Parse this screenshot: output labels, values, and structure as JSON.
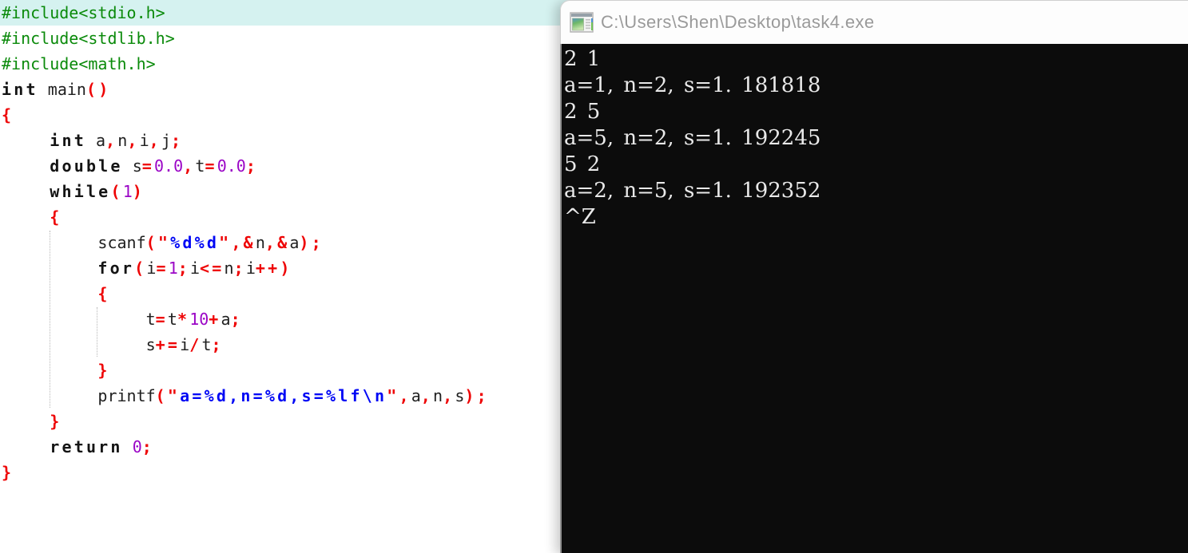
{
  "editor": {
    "background": "#ffffff",
    "active_line_background": "#d5f2f0",
    "token_colors": {
      "include_directive": "#0a8a0a",
      "keyword": "#141414",
      "plain": "#1f1f1f",
      "punctuation": "#ee0405",
      "number": "#9b06c6",
      "string_format": "#0007f5"
    },
    "lines": [
      [
        [
          "inc",
          "#include<stdio.h>"
        ]
      ],
      [
        [
          "inc",
          "#include<stdlib.h>"
        ]
      ],
      [
        [
          "inc",
          "#include<math.h>"
        ]
      ],
      [
        [
          "kw",
          "int"
        ],
        [
          "pl",
          " main"
        ],
        [
          "pu",
          "()"
        ]
      ],
      [
        [
          "pu",
          "{"
        ]
      ],
      [
        [
          "pl",
          "     "
        ],
        [
          "kw",
          "int"
        ],
        [
          "pl",
          " a"
        ],
        [
          "pu",
          ","
        ],
        [
          "pl",
          "n"
        ],
        [
          "pu",
          ","
        ],
        [
          "pl",
          "i"
        ],
        [
          "pu",
          ","
        ],
        [
          "pl",
          "j"
        ],
        [
          "pu",
          ";"
        ]
      ],
      [
        [
          "pl",
          "     "
        ],
        [
          "kw",
          "double"
        ],
        [
          "pl",
          " s"
        ],
        [
          "pu",
          "="
        ],
        [
          "num",
          "0.0"
        ],
        [
          "pu",
          ","
        ],
        [
          "pl",
          "t"
        ],
        [
          "pu",
          "="
        ],
        [
          "num",
          "0.0"
        ],
        [
          "pu",
          ";"
        ]
      ],
      [
        [
          "pl",
          "     "
        ],
        [
          "kw",
          "while"
        ],
        [
          "pu",
          "("
        ],
        [
          "num",
          "1"
        ],
        [
          "pu",
          ")"
        ]
      ],
      [
        [
          "pl",
          "     "
        ],
        [
          "pu",
          "{"
        ]
      ],
      [
        [
          "pl",
          "          scanf"
        ],
        [
          "pu",
          "(\""
        ],
        [
          "str",
          "%d%d"
        ],
        [
          "pu",
          "\",&"
        ],
        [
          "pl",
          "n"
        ],
        [
          "pu",
          ",&"
        ],
        [
          "pl",
          "a"
        ],
        [
          "pu",
          ");"
        ]
      ],
      [
        [
          "pl",
          "          "
        ],
        [
          "kw",
          "for"
        ],
        [
          "pu",
          "("
        ],
        [
          "pl",
          "i"
        ],
        [
          "pu",
          "="
        ],
        [
          "num",
          "1"
        ],
        [
          "pu",
          ";"
        ],
        [
          "pl",
          "i"
        ],
        [
          "pu",
          "<="
        ],
        [
          "pl",
          "n"
        ],
        [
          "pu",
          ";"
        ],
        [
          "pl",
          "i"
        ],
        [
          "pu",
          "++)"
        ]
      ],
      [
        [
          "pl",
          "          "
        ],
        [
          "pu",
          "{"
        ]
      ],
      [
        [
          "pl",
          "               t"
        ],
        [
          "pu",
          "="
        ],
        [
          "pl",
          "t"
        ],
        [
          "pu",
          "*"
        ],
        [
          "num",
          "10"
        ],
        [
          "pu",
          "+"
        ],
        [
          "pl",
          "a"
        ],
        [
          "pu",
          ";"
        ]
      ],
      [
        [
          "pl",
          "               s"
        ],
        [
          "pu",
          "+="
        ],
        [
          "pl",
          "i"
        ],
        [
          "pu",
          "/"
        ],
        [
          "pl",
          "t"
        ],
        [
          "pu",
          ";"
        ]
      ],
      [
        [
          "pl",
          "          "
        ],
        [
          "pu",
          "}"
        ]
      ],
      [
        [
          "pl",
          "          printf"
        ],
        [
          "pu",
          "(\""
        ],
        [
          "str",
          "a=%d,n=%d,s=%lf\\n"
        ],
        [
          "pu",
          "\","
        ],
        [
          "pl",
          "a"
        ],
        [
          "pu",
          ","
        ],
        [
          "pl",
          "n"
        ],
        [
          "pu",
          ","
        ],
        [
          "pl",
          "s"
        ],
        [
          "pu",
          ");"
        ]
      ],
      [
        [
          "pl",
          "     "
        ],
        [
          "pu",
          "}"
        ]
      ],
      [
        [
          "pl",
          "     "
        ],
        [
          "kw",
          "return"
        ],
        [
          "pl",
          " "
        ],
        [
          "num",
          "0"
        ],
        [
          "pu",
          ";"
        ]
      ],
      [
        [
          "pu",
          "}"
        ]
      ]
    ]
  },
  "console": {
    "title": "C:\\Users\\Shen\\Desktop\\task4.exe",
    "icon": "console-window-icon",
    "background": "#0c0c0c",
    "text_color": "#e9e9e9",
    "titlebar_background": "#fdfdfd",
    "title_text_color": "#9a9a9a",
    "lines": [
      "2 1",
      "a=1, n=2, s=1. 181818",
      "2 5",
      "a=5, n=2, s=1. 192245",
      "5 2",
      "a=2, n=5, s=1. 192352",
      "^Z"
    ]
  }
}
